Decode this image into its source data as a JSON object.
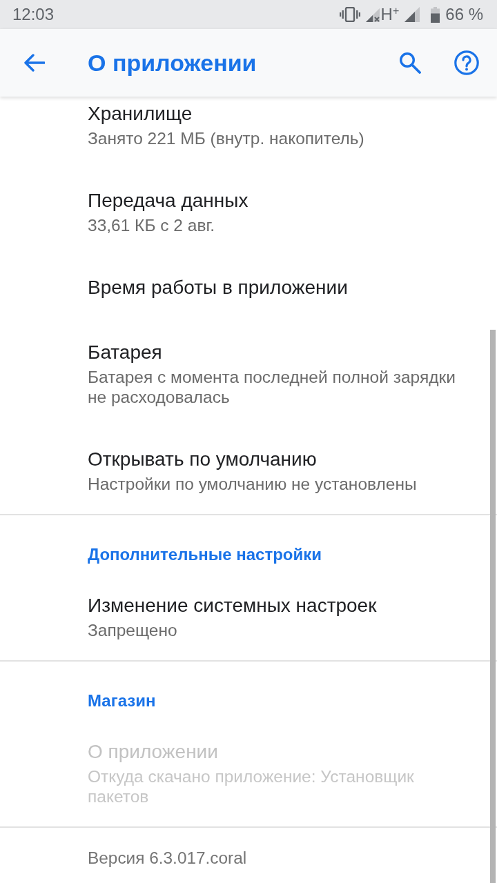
{
  "status_bar": {
    "time": "12:03",
    "network_type": "H$^{+}$",
    "battery": "66 %"
  },
  "app_bar": {
    "title": "О приложении"
  },
  "sections": [
    {
      "items": [
        {
          "title": "Хранилище",
          "summary": "Занято 221 МБ (внутр. накопитель)",
          "disabled": false
        },
        {
          "title": "Передача данных",
          "summary": "33,61 КБ с 2 авг.",
          "disabled": false
        },
        {
          "title": "Время работы в приложении",
          "disabled": false
        },
        {
          "title": "Батарея",
          "summary": "Батарея с момента последней полной зарядки не расходовалась",
          "disabled": false
        },
        {
          "title": "Открывать по умолчанию",
          "summary": "Настройки по умолчанию не установлены",
          "disabled": false
        }
      ]
    },
    {
      "header": "Дополнительные настройки",
      "items": [
        {
          "title": "Изменение системных настроек",
          "summary": "Запрещено",
          "disabled": false
        }
      ]
    },
    {
      "header": "Магазин",
      "items": [
        {
          "title": "О приложении",
          "summary": "Откуда скачано приложение: Установщик пакетов",
          "disabled": true
        }
      ]
    }
  ],
  "footer": {
    "version": "Версия 6.3.017.coral"
  }
}
